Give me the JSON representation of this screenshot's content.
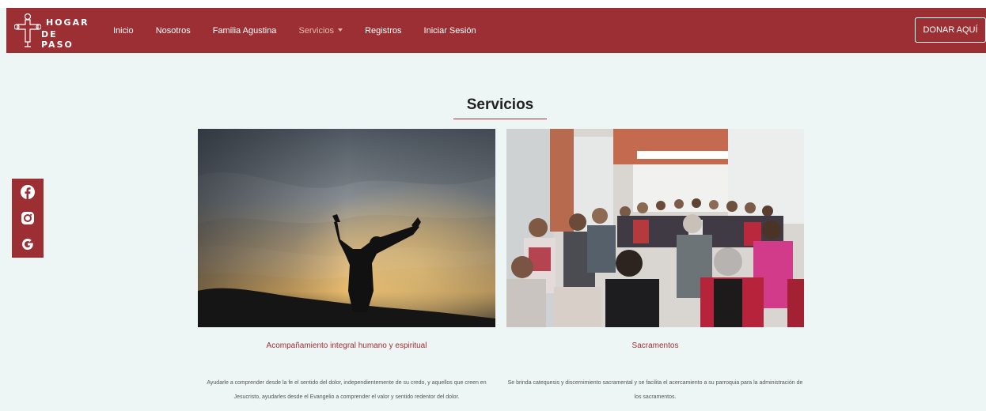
{
  "header": {
    "logo_line1": "HOGAR",
    "logo_line2": "DE PASO",
    "nav": [
      "Inicio",
      "Nosotros",
      "Familia Agustina",
      "Servicios",
      "Registros",
      "Iniciar Sesión"
    ],
    "active_item": "Servicios",
    "donate_label": "DONAR AQUÍ"
  },
  "social": {
    "icons": [
      "facebook-icon",
      "instagram-icon",
      "google-icon"
    ]
  },
  "section": {
    "title": "Servicios"
  },
  "services": [
    {
      "title": "Acompañamiento integral humano y espiritual",
      "description": "Ayudarle a comprender desde la fe el sentido del dolor, independientemente de su credo, y aquellos que creen en Jesucristo, ayudarles desde el Evangelio a comprender el valor y sentido redentor del dolor."
    },
    {
      "title": "Sacramentos",
      "description": "Se brinda catequesis y discernimiento sacramental y se facilita el acercamiento a su parroquia para la administración de los sacramentos."
    }
  ],
  "colors": {
    "brand": "#9b2f33",
    "background": "#eef5f5",
    "active_nav": "#e8b8a6"
  }
}
